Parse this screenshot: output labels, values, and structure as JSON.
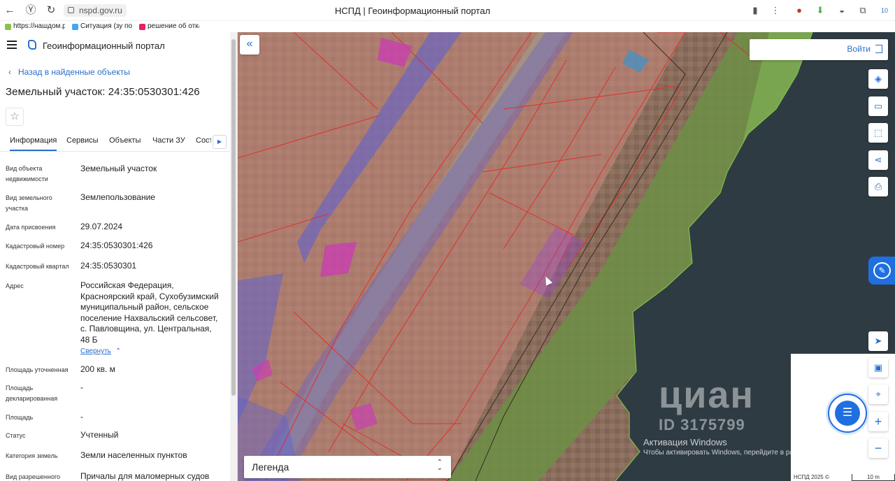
{
  "browser": {
    "url": "nspd.gov.ru",
    "tab_title": "НСПД | Геоинформационный портал",
    "bookmarks": [
      "https://нашдом.р",
      "Ситуация (зу под",
      "решение об отка"
    ],
    "badge_count": "10"
  },
  "sidebar": {
    "portal_title": "Геоинформационный портал",
    "back_link": "Назад в найденные объекты",
    "parcel_title": "Земельный участок: 24:35:0530301:426",
    "tabs": [
      "Информация",
      "Сервисы",
      "Объекты",
      "Части ЗУ",
      "Соста"
    ],
    "active_tab": "Информация",
    "fields": [
      {
        "label": "Вид объекта недвижимости",
        "value": "Земельный участок"
      },
      {
        "label": "Вид земельного участка",
        "value": "Землепользование"
      },
      {
        "label": "Дата присвоения",
        "value": "29.07.2024"
      },
      {
        "label": "Кадастровый номер",
        "value": "24:35:0530301:426"
      },
      {
        "label": "Кадастровый квартал",
        "value": "24:35:0530301"
      },
      {
        "label": "Адрес",
        "value": "Российская Федерация, Красноярский край, Сухобузимский муниципальный район, сельское поселение Нахвальский сельсовет, с. Павловщина, ул. Центральная, 48 Б"
      },
      {
        "label": "Площадь уточненная",
        "value": "200 кв. м"
      },
      {
        "label": "Площадь декларированная",
        "value": "-"
      },
      {
        "label": "Площадь",
        "value": "-"
      },
      {
        "label": "Статус",
        "value": "Учтенный"
      },
      {
        "label": "Категория земель",
        "value": "Земли населенных пунктов"
      },
      {
        "label": "Вид разрешенного",
        "value": "Причалы для маломерных судов"
      }
    ],
    "collapse_label": "Свернуть"
  },
  "map": {
    "login_label": "Войти",
    "legend_label": "Легенда",
    "watermark_name": "циан",
    "watermark_id": "ID 3175799",
    "windows_title": "Активация Windows",
    "windows_sub": "Чтобы активировать Windows, перейдите в раздел \"Параметры\".",
    "copyright": "НСПД 2025 ©",
    "scale_label": "10 m",
    "colors": {
      "accent": "#2a6fc9",
      "parcel_outline": "#e0302a",
      "selected_parcel": "#9b3fd6",
      "road_overlay": "#5a5fd8",
      "building_overlay": "#c93fb0",
      "water": "#2f3f48",
      "shore_green": "#7cc04a"
    }
  }
}
